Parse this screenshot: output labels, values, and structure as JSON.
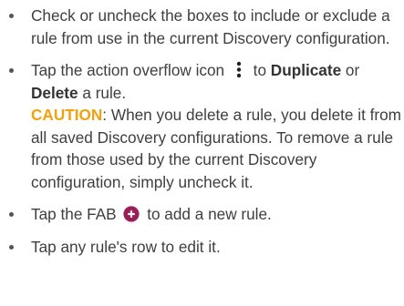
{
  "bullets": {
    "include_exclude": "Check or uncheck the boxes to include or exclude a rule from use in the current Discovery configuration.",
    "overflow": {
      "before_icon": "Tap the action overflow icon",
      "icon": "vertical-ellipsis-icon",
      "after_icon": " to ",
      "duplicate": "Duplicate",
      "or": " or ",
      "delete": "Delete",
      "end": " a rule.",
      "caution_label": "CAUTION",
      "caution_text": ": When you delete a rule, you delete it from all saved Discovery configurations. To remove a rule from those used by the current Discovery configuration, simply uncheck it."
    },
    "fab": {
      "before_icon": "Tap the FAB",
      "icon": "plus-fab-icon",
      "after_icon": " to add a new rule."
    },
    "edit": "Tap any rule's row to edit it."
  },
  "colors": {
    "caution": "#f2a10f",
    "fab": "#9b1f57",
    "text": "#3f3f3f"
  }
}
